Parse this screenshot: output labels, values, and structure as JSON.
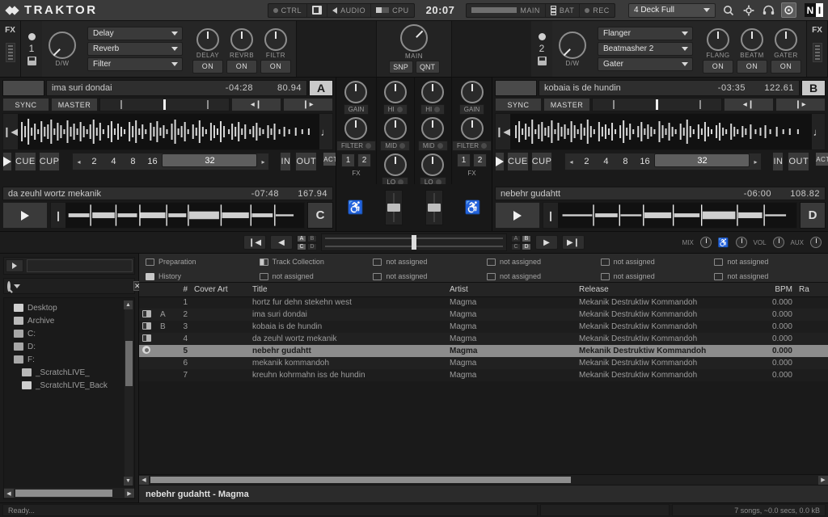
{
  "app": {
    "title": "TRAKTOR"
  },
  "topbar": {
    "ctrl": "CTRL",
    "audio": "AUDIO",
    "cpu": "CPU",
    "clock": "20:07",
    "main": "MAIN",
    "bat": "BAT",
    "rec": "REC",
    "layout": "4 Deck Full",
    "icons": [
      "search-icon",
      "gear-icon",
      "headphones-icon",
      "circle-target-icon"
    ],
    "ni_left": "N",
    "ni_right": "I"
  },
  "fx": {
    "left": {
      "panel_label": "FX",
      "unit_number": "1",
      "dw_label": "D/W",
      "slots": [
        "Delay",
        "Reverb",
        "Filter"
      ],
      "knobs": [
        {
          "label": "DELAY",
          "button": "ON"
        },
        {
          "label": "REVRB",
          "button": "ON"
        },
        {
          "label": "FILTR",
          "button": "ON"
        }
      ]
    },
    "right": {
      "panel_label": "FX",
      "unit_number": "2",
      "dw_label": "D/W",
      "slots": [
        "Flanger",
        "Beatmasher 2",
        "Gater"
      ],
      "knobs": [
        {
          "label": "FLANG",
          "button": "ON"
        },
        {
          "label": "BEATM",
          "button": "ON"
        },
        {
          "label": "GATER",
          "button": "ON"
        }
      ]
    },
    "master": {
      "label": "MAIN",
      "snap": "SNP",
      "quant": "QNT"
    }
  },
  "decks": {
    "a": {
      "letter": "A",
      "title": "ima suri dondai",
      "time": "-04:28",
      "bpm": "80.94",
      "sync": "SYNC",
      "master": "MASTER",
      "play": "play-icon",
      "cue": "CUE",
      "cup": "CUP",
      "loop_sizes": [
        "2",
        "4",
        "8",
        "16",
        "32"
      ],
      "loop_selected": "32",
      "in": "IN",
      "out": "OUT",
      "active": "ACTIVE"
    },
    "b": {
      "letter": "B",
      "title": "kobaia is de hundin",
      "time": "-03:35",
      "bpm": "122.61",
      "sync": "SYNC",
      "master": "MASTER",
      "play": "play-icon",
      "cue": "CUE",
      "cup": "CUP",
      "loop_sizes": [
        "2",
        "4",
        "8",
        "16",
        "32"
      ],
      "loop_selected": "32",
      "in": "IN",
      "out": "OUT",
      "active": "ACTIVE"
    },
    "c": {
      "letter": "C",
      "title": "da zeuhl wortz mekanik",
      "time": "-07:48",
      "bpm": "167.94"
    },
    "d": {
      "letter": "D",
      "title": "nebehr gudahtt",
      "time": "-06:00",
      "bpm": "108.82"
    }
  },
  "mixer": {
    "channels": [
      {
        "gain": "GAIN",
        "filter": "FILTER",
        "fx": [
          "1",
          "2"
        ],
        "fx_label": "FX"
      },
      {
        "hi": "HI",
        "mid": "MID",
        "lo": "LO"
      },
      {
        "hi": "HI",
        "mid": "MID",
        "lo": "LO"
      },
      {
        "gain": "GAIN",
        "filter": "FILTER",
        "fx": [
          "1",
          "2"
        ],
        "fx_label": "FX"
      }
    ]
  },
  "crossfader": {
    "left_assign": [
      [
        "A",
        "B"
      ],
      [
        "C",
        "D"
      ]
    ],
    "right_assign": [
      [
        "A",
        "B"
      ],
      [
        "C",
        "D"
      ]
    ],
    "mix_label": "MIX",
    "vol_label": "VOL",
    "aux_label": "AUX"
  },
  "browser": {
    "search_placeholder": "",
    "search_value": "",
    "prep_value": "",
    "tree": [
      {
        "label": "Desktop",
        "type": "folder-open"
      },
      {
        "label": "Archive",
        "type": "folder"
      },
      {
        "label": "C:",
        "type": "drive"
      },
      {
        "label": "D:",
        "type": "drive"
      },
      {
        "label": "F:",
        "type": "drive"
      },
      {
        "label": "_ScratchLIVE_",
        "type": "folder"
      },
      {
        "label": "_ScratchLIVE_Back",
        "type": "folder"
      }
    ],
    "favorites": [
      {
        "label": "Preparation",
        "icon": "outline"
      },
      {
        "label": "History",
        "icon": "solid"
      },
      {
        "label": "Track Collection",
        "icon": "half"
      },
      {
        "label": "not assigned",
        "icon": "outline"
      },
      {
        "label": "not assigned",
        "icon": "outline"
      },
      {
        "label": "not assigned",
        "icon": "outline"
      },
      {
        "label": "not assigned",
        "icon": "outline"
      },
      {
        "label": "not assigned",
        "icon": "outline"
      },
      {
        "label": "not assigned",
        "icon": "outline"
      },
      {
        "label": "not assigned",
        "icon": "outline"
      },
      {
        "label": "not assigned",
        "icon": "outline"
      },
      {
        "label": "not assigned",
        "icon": "outline"
      }
    ],
    "columns": [
      "#",
      "Cover Art",
      "Title",
      "Artist",
      "Release",
      "BPM",
      "Ra"
    ],
    "rows": [
      {
        "deck": "",
        "slot": "",
        "num": "1",
        "title": "hortz fur dehn stekehn west",
        "artist": "Magma",
        "release": "Mekanik Destruktiw Kommandoh",
        "bpm": "0.000",
        "selected": false
      },
      {
        "deck": "loaded",
        "slot": "A",
        "num": "2",
        "title": "ima suri dondai",
        "artist": "Magma",
        "release": "Mekanik Destruktiw Kommandoh",
        "bpm": "0.000",
        "selected": false
      },
      {
        "deck": "loaded",
        "slot": "B",
        "num": "3",
        "title": "kobaia is de hundin",
        "artist": "Magma",
        "release": "Mekanik Destruktiw Kommandoh",
        "bpm": "0.000",
        "selected": false
      },
      {
        "deck": "loaded",
        "slot": "",
        "num": "4",
        "title": "da zeuhl wortz mekanik",
        "artist": "Magma",
        "release": "Mekanik Destruktiw Kommandoh",
        "bpm": "0.000",
        "selected": false
      },
      {
        "deck": "circle",
        "slot": "",
        "num": "5",
        "title": "nebehr gudahtt",
        "artist": "Magma",
        "release": "Mekanik Destruktiw Kommandoh",
        "bpm": "0.000",
        "selected": true
      },
      {
        "deck": "",
        "slot": "",
        "num": "6",
        "title": "mekanik kommandoh",
        "artist": "Magma",
        "release": "Mekanik Destruktiw Kommandoh",
        "bpm": "0.000",
        "selected": false
      },
      {
        "deck": "",
        "slot": "",
        "num": "7",
        "title": "kreuhn kohrmahn iss de hundin",
        "artist": "Magma",
        "release": "Mekanik Destruktiw Kommandoh",
        "bpm": "0.000",
        "selected": false
      }
    ],
    "now_playing": "nebehr gudahtt - Magma",
    "status_left": "Ready...",
    "status_right": "7 songs, ~0.0 secs, 0.0 kB"
  }
}
